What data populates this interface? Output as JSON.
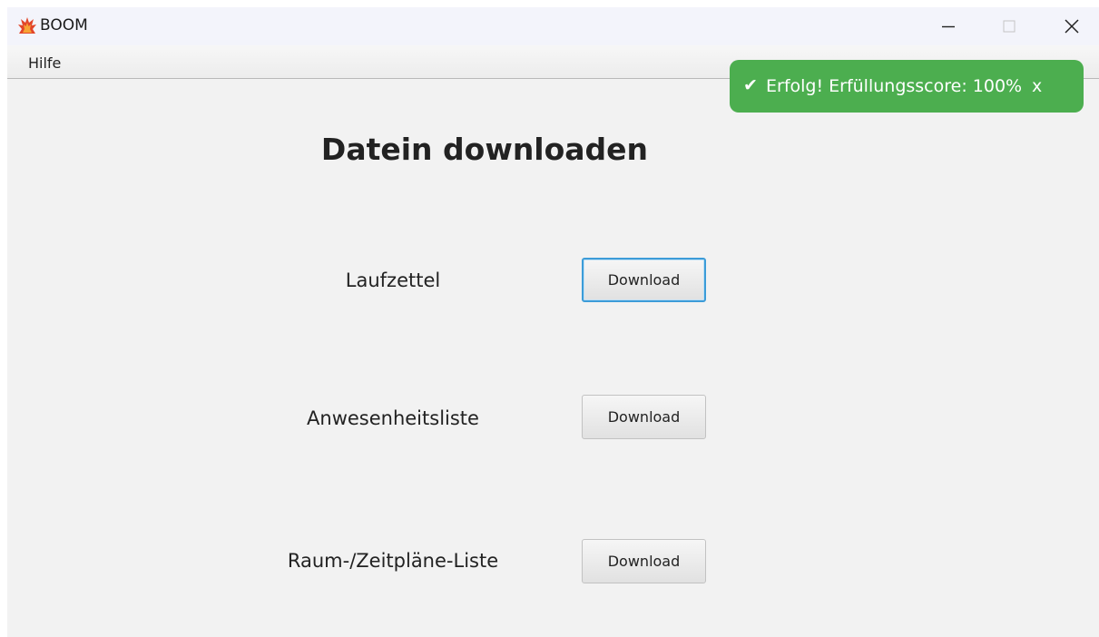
{
  "window": {
    "title": "BOOM",
    "app_icon": "boom-flame-icon",
    "controls": {
      "minimize": "minimize-icon",
      "maximize": "maximize-icon",
      "close": "close-icon"
    }
  },
  "menu": {
    "items": [
      {
        "label": "Hilfe"
      }
    ]
  },
  "main": {
    "title": "Datein downloaden",
    "rows": [
      {
        "label": "Laufzettel",
        "button": "Download",
        "focused": true
      },
      {
        "label": "Anwesenheitsliste",
        "button": "Download",
        "focused": false
      },
      {
        "label": "Raum-/Zeitpläne-Liste",
        "button": "Download",
        "focused": false
      }
    ]
  },
  "toast": {
    "icon": "checkmark-icon",
    "check_glyph": "✔",
    "message": "Erfolg! Erfüllungsscore: 100%",
    "close_label": "x",
    "color": "#4cae4f"
  },
  "colors": {
    "focus_border": "#3c9cd8",
    "background": "#f2f2f2",
    "titlebar": "#f3f4fb"
  }
}
